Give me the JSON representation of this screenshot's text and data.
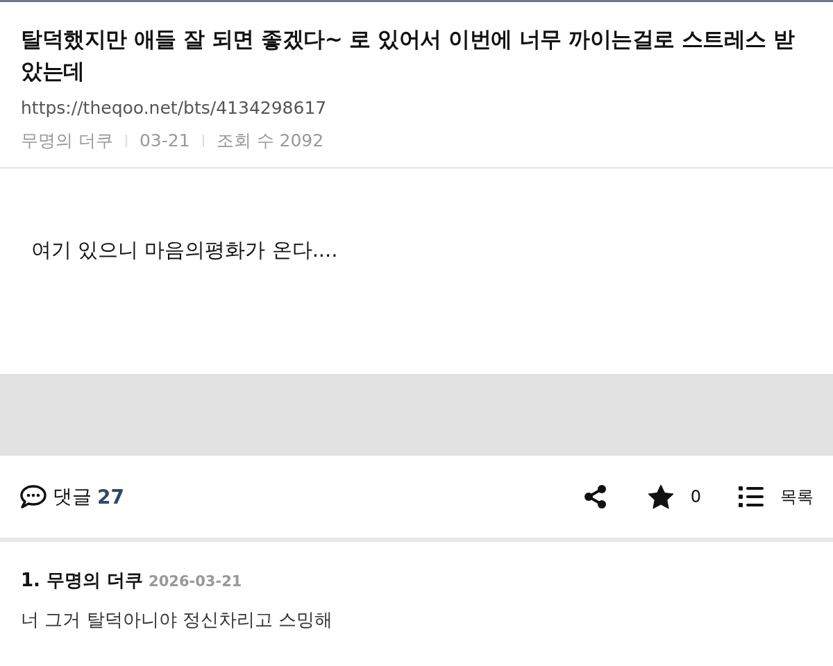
{
  "post": {
    "title": "탈덕했지만 애들 잘 되면 좋겠다~ 로 있어서 이번에 너무 까이는걸로 스트레스 받았는데",
    "url": "https://theqoo.net/bts/4134298617",
    "author": "무명의 더쿠",
    "date": "03-21",
    "views": "조회 수 2092"
  },
  "body": "여기 있으니 마음의평화가 온다....",
  "actions": {
    "comments_label": "댓글",
    "comments_count": "27",
    "star_count": "0",
    "list_label": "목록"
  },
  "comments": [
    {
      "author": "1. 무명의 더쿠",
      "date": "2026-03-21",
      "text": "너 그거 탈덕아니야 정신차리고 스밍해"
    }
  ]
}
